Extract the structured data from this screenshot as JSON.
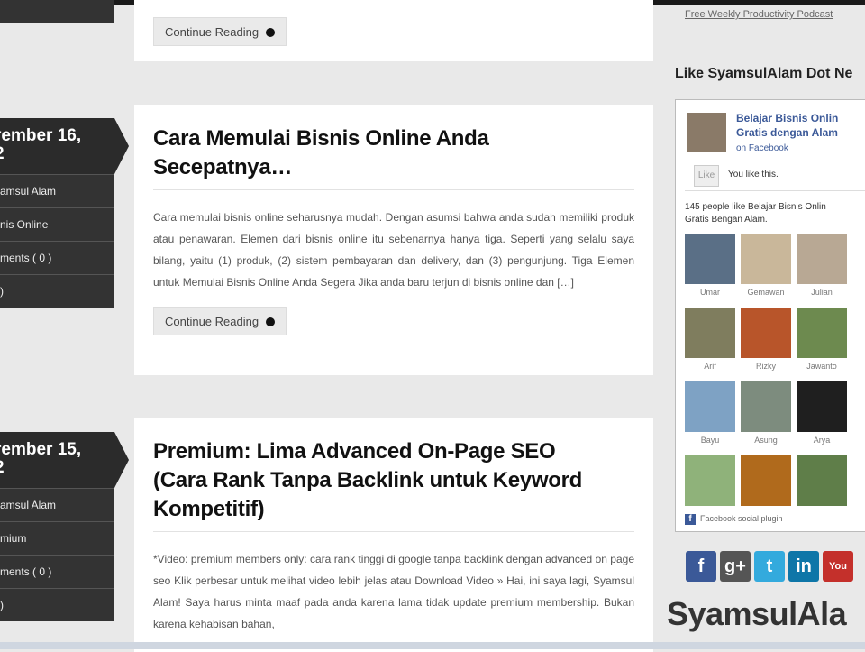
{
  "top_card": {
    "continue_label": "Continue Reading"
  },
  "posts": [
    {
      "date": "rember 16,",
      "date2": "2",
      "author": "amsul Alam",
      "category": "nis Online",
      "comments": "ments ( 0 )",
      "extra": ")",
      "title_line1": "Cara Memulai Bisnis Online Anda",
      "title_line2": "Secepatnya…",
      "excerpt": "Cara memulai bisnis online seharusnya mudah. Dengan asumsi bahwa anda sudah memiliki produk atau penawaran. Elemen dari bisnis online itu sebenarnya hanya tiga. Seperti yang selalu saya bilang, yaitu (1) produk, (2) sistem pembayaran dan delivery, dan (3) pengunjung. Tiga Elemen untuk Memulai Bisnis Online Anda Segera Jika anda baru terjun di bisnis online dan […]",
      "continue_label": "Continue Reading"
    },
    {
      "date": "rember 15,",
      "date2": "2",
      "author": "amsul Alam",
      "category": "mium",
      "comments": "ments ( 0 )",
      "extra": ")",
      "title_line1": "Premium: Lima Advanced On-Page SEO",
      "title_line2": "(Cara Rank Tanpa Backlink untuk Keyword",
      "title_line3": "Kompetitif)",
      "excerpt": "*Video: premium members only: cara rank tinggi di google tanpa backlink dengan advanced on page seo Klik perbesar untuk melihat video lebih jelas atau Download Video » Hai, ini saya lagi, Syamsul Alam! Saya harus minta maaf pada anda karena lama tidak update premium membership. Bukan karena kehabisan bahan,"
    }
  ],
  "sidebar": {
    "podcast_link": "Free Weekly Productivity Podcast",
    "like_title": "Like SyamsulAlam Dot Ne",
    "fb": {
      "page_name_line1": "Belajar Bisnis Onlin",
      "page_name_line2": "Gratis dengan Alam",
      "on_facebook": "on Facebook",
      "like_button": "Like",
      "you_like": "You like this.",
      "count_line1": "145 people like Belajar Bisnis Onlin",
      "count_line2": "Gratis Bengan Alam.",
      "faces": [
        {
          "name": "Umar",
          "color": "#5a6f86"
        },
        {
          "name": "Gemawan",
          "color": "#c9b79a"
        },
        {
          "name": "Julian",
          "color": "#b8a894"
        },
        {
          "name": "Arif",
          "color": "#7f7d5e"
        },
        {
          "name": "Rizky",
          "color": "#b8552a"
        },
        {
          "name": "Jawanto",
          "color": "#6d8a4f"
        },
        {
          "name": "Bayu",
          "color": "#7ea2c4"
        },
        {
          "name": "Asung",
          "color": "#7d8c7e"
        },
        {
          "name": "Arya",
          "color": "#1f1f1f"
        },
        {
          "name": "",
          "color": "#8fb27a"
        },
        {
          "name": "",
          "color": "#b06a1c"
        },
        {
          "name": "",
          "color": "#5f7e49"
        }
      ],
      "footer": "Facebook social plugin"
    },
    "social_icons": [
      {
        "icon": "facebook-icon",
        "glyph": "f",
        "color": "#3b5998"
      },
      {
        "icon": "googleplus-icon",
        "glyph": "g+",
        "color": "#555555"
      },
      {
        "icon": "twitter-icon",
        "glyph": "t",
        "color": "#33aadd"
      },
      {
        "icon": "linkedin-icon",
        "glyph": "in",
        "color": "#0e76a8"
      },
      {
        "icon": "youtube-icon",
        "glyph": "You",
        "color": "#c4302b"
      }
    ],
    "brand": "SyamsulAla"
  }
}
